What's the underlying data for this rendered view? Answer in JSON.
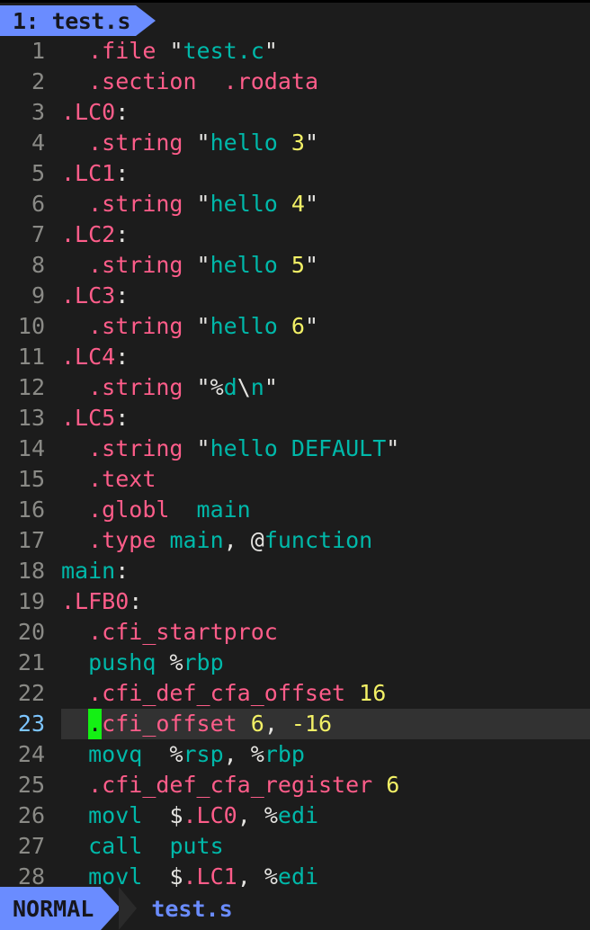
{
  "editor": {
    "name": "neovim",
    "colors": {
      "background": "#1c1c1c",
      "current_line_bg": "#323232",
      "accent_blue": "#6a8cff",
      "line_number": "#8a8a86",
      "current_line_number": "#7cc5ff",
      "directive_pink": "#ff5d8a",
      "string_teal": "#00b8a9",
      "number_yellow": "#f2f066",
      "punct_white": "#e4e3e0",
      "cursor_green": "#14f014"
    }
  },
  "tabline": {
    "tabs": [
      {
        "label": "1: test.s",
        "active": true
      }
    ]
  },
  "statusline": {
    "mode": "NORMAL",
    "filename": "test.s",
    "right": ""
  },
  "buffer": {
    "filename": "test.s",
    "cursor_line": 23,
    "cursor_col": 3,
    "lines": [
      {
        "n": "1",
        "tokens": [
          {
            "t": "  ",
            "c": "punct"
          },
          {
            "t": ".file",
            "c": "dir"
          },
          {
            "t": " ",
            "c": "punct"
          },
          {
            "t": "\"",
            "c": "punct"
          },
          {
            "t": "test.c",
            "c": "str"
          },
          {
            "t": "\"",
            "c": "punct"
          }
        ]
      },
      {
        "n": "2",
        "tokens": [
          {
            "t": "  ",
            "c": "punct"
          },
          {
            "t": ".section",
            "c": "dir"
          },
          {
            "t": "  ",
            "c": "punct"
          },
          {
            "t": ".rodata",
            "c": "dir"
          }
        ]
      },
      {
        "n": "3",
        "tokens": [
          {
            "t": ".LC0",
            "c": "dir"
          },
          {
            "t": ":",
            "c": "punct"
          }
        ]
      },
      {
        "n": "4",
        "tokens": [
          {
            "t": "  ",
            "c": "punct"
          },
          {
            "t": ".string",
            "c": "dir"
          },
          {
            "t": " ",
            "c": "punct"
          },
          {
            "t": "\"",
            "c": "punct"
          },
          {
            "t": "hello ",
            "c": "str"
          },
          {
            "t": "3",
            "c": "num"
          },
          {
            "t": "\"",
            "c": "punct"
          }
        ]
      },
      {
        "n": "5",
        "tokens": [
          {
            "t": ".LC1",
            "c": "dir"
          },
          {
            "t": ":",
            "c": "punct"
          }
        ]
      },
      {
        "n": "6",
        "tokens": [
          {
            "t": "  ",
            "c": "punct"
          },
          {
            "t": ".string",
            "c": "dir"
          },
          {
            "t": " ",
            "c": "punct"
          },
          {
            "t": "\"",
            "c": "punct"
          },
          {
            "t": "hello ",
            "c": "str"
          },
          {
            "t": "4",
            "c": "num"
          },
          {
            "t": "\"",
            "c": "punct"
          }
        ]
      },
      {
        "n": "7",
        "tokens": [
          {
            "t": ".LC2",
            "c": "dir"
          },
          {
            "t": ":",
            "c": "punct"
          }
        ]
      },
      {
        "n": "8",
        "tokens": [
          {
            "t": "  ",
            "c": "punct"
          },
          {
            "t": ".string",
            "c": "dir"
          },
          {
            "t": " ",
            "c": "punct"
          },
          {
            "t": "\"",
            "c": "punct"
          },
          {
            "t": "hello ",
            "c": "str"
          },
          {
            "t": "5",
            "c": "num"
          },
          {
            "t": "\"",
            "c": "punct"
          }
        ]
      },
      {
        "n": "9",
        "tokens": [
          {
            "t": ".LC3",
            "c": "dir"
          },
          {
            "t": ":",
            "c": "punct"
          }
        ]
      },
      {
        "n": "10",
        "tokens": [
          {
            "t": "  ",
            "c": "punct"
          },
          {
            "t": ".string",
            "c": "dir"
          },
          {
            "t": " ",
            "c": "punct"
          },
          {
            "t": "\"",
            "c": "punct"
          },
          {
            "t": "hello ",
            "c": "str"
          },
          {
            "t": "6",
            "c": "num"
          },
          {
            "t": "\"",
            "c": "punct"
          }
        ]
      },
      {
        "n": "11",
        "tokens": [
          {
            "t": ".LC4",
            "c": "dir"
          },
          {
            "t": ":",
            "c": "punct"
          }
        ]
      },
      {
        "n": "12",
        "tokens": [
          {
            "t": "  ",
            "c": "punct"
          },
          {
            "t": ".string",
            "c": "dir"
          },
          {
            "t": " ",
            "c": "punct"
          },
          {
            "t": "\"",
            "c": "punct"
          },
          {
            "t": "%",
            "c": "punct"
          },
          {
            "t": "d",
            "c": "str"
          },
          {
            "t": "\\",
            "c": "punct"
          },
          {
            "t": "n",
            "c": "str"
          },
          {
            "t": "\"",
            "c": "punct"
          }
        ]
      },
      {
        "n": "13",
        "tokens": [
          {
            "t": ".LC5",
            "c": "dir"
          },
          {
            "t": ":",
            "c": "punct"
          }
        ]
      },
      {
        "n": "14",
        "tokens": [
          {
            "t": "  ",
            "c": "punct"
          },
          {
            "t": ".string",
            "c": "dir"
          },
          {
            "t": " ",
            "c": "punct"
          },
          {
            "t": "\"",
            "c": "punct"
          },
          {
            "t": "hello DEFAULT",
            "c": "str"
          },
          {
            "t": "\"",
            "c": "punct"
          }
        ]
      },
      {
        "n": "15",
        "tokens": [
          {
            "t": "  ",
            "c": "punct"
          },
          {
            "t": ".text",
            "c": "dir"
          }
        ]
      },
      {
        "n": "16",
        "tokens": [
          {
            "t": "  ",
            "c": "punct"
          },
          {
            "t": ".globl",
            "c": "dir"
          },
          {
            "t": "  ",
            "c": "punct"
          },
          {
            "t": "main",
            "c": "str"
          }
        ]
      },
      {
        "n": "17",
        "tokens": [
          {
            "t": "  ",
            "c": "punct"
          },
          {
            "t": ".type",
            "c": "dir"
          },
          {
            "t": " ",
            "c": "punct"
          },
          {
            "t": "main",
            "c": "str"
          },
          {
            "t": ", ",
            "c": "punct"
          },
          {
            "t": "@",
            "c": "punct"
          },
          {
            "t": "function",
            "c": "str"
          }
        ]
      },
      {
        "n": "18",
        "tokens": [
          {
            "t": "main",
            "c": "str"
          },
          {
            "t": ":",
            "c": "punct"
          }
        ]
      },
      {
        "n": "19",
        "tokens": [
          {
            "t": ".LFB0",
            "c": "dir"
          },
          {
            "t": ":",
            "c": "punct"
          }
        ]
      },
      {
        "n": "20",
        "tokens": [
          {
            "t": "  ",
            "c": "punct"
          },
          {
            "t": ".cfi_startproc",
            "c": "dir"
          }
        ]
      },
      {
        "n": "21",
        "tokens": [
          {
            "t": "  ",
            "c": "punct"
          },
          {
            "t": "pushq",
            "c": "str"
          },
          {
            "t": " ",
            "c": "punct"
          },
          {
            "t": "%",
            "c": "punct"
          },
          {
            "t": "rbp",
            "c": "id"
          }
        ]
      },
      {
        "n": "22",
        "tokens": [
          {
            "t": "  ",
            "c": "punct"
          },
          {
            "t": ".cfi_def_cfa_offset",
            "c": "dir"
          },
          {
            "t": " ",
            "c": "punct"
          },
          {
            "t": "16",
            "c": "num"
          }
        ]
      },
      {
        "n": "23",
        "current": true,
        "tokens": [
          {
            "t": "  ",
            "c": "punct"
          },
          {
            "t": ".",
            "c": "cursor"
          },
          {
            "t": "cfi_offset",
            "c": "dir"
          },
          {
            "t": " ",
            "c": "punct"
          },
          {
            "t": "6",
            "c": "num"
          },
          {
            "t": ", ",
            "c": "punct"
          },
          {
            "t": "-16",
            "c": "num"
          }
        ]
      },
      {
        "n": "24",
        "tokens": [
          {
            "t": "  ",
            "c": "punct"
          },
          {
            "t": "movq",
            "c": "str"
          },
          {
            "t": "  ",
            "c": "punct"
          },
          {
            "t": "%",
            "c": "punct"
          },
          {
            "t": "rsp",
            "c": "id"
          },
          {
            "t": ", ",
            "c": "punct"
          },
          {
            "t": "%",
            "c": "punct"
          },
          {
            "t": "rbp",
            "c": "id"
          }
        ]
      },
      {
        "n": "25",
        "tokens": [
          {
            "t": "  ",
            "c": "punct"
          },
          {
            "t": ".cfi_def_cfa_register",
            "c": "dir"
          },
          {
            "t": " ",
            "c": "punct"
          },
          {
            "t": "6",
            "c": "num"
          }
        ]
      },
      {
        "n": "26",
        "tokens": [
          {
            "t": "  ",
            "c": "punct"
          },
          {
            "t": "movl",
            "c": "str"
          },
          {
            "t": "  ",
            "c": "punct"
          },
          {
            "t": "$",
            "c": "punct"
          },
          {
            "t": ".LC0",
            "c": "dir"
          },
          {
            "t": ", ",
            "c": "punct"
          },
          {
            "t": "%",
            "c": "punct"
          },
          {
            "t": "edi",
            "c": "id"
          }
        ]
      },
      {
        "n": "27",
        "tokens": [
          {
            "t": "  ",
            "c": "punct"
          },
          {
            "t": "call",
            "c": "str"
          },
          {
            "t": "  ",
            "c": "punct"
          },
          {
            "t": "puts",
            "c": "str"
          }
        ]
      },
      {
        "n": "28",
        "tokens": [
          {
            "t": "  ",
            "c": "punct"
          },
          {
            "t": "movl",
            "c": "str"
          },
          {
            "t": "  ",
            "c": "punct"
          },
          {
            "t": "$",
            "c": "punct"
          },
          {
            "t": ".LC1",
            "c": "dir"
          },
          {
            "t": ", ",
            "c": "punct"
          },
          {
            "t": "%",
            "c": "punct"
          },
          {
            "t": "edi",
            "c": "id"
          }
        ]
      }
    ]
  }
}
